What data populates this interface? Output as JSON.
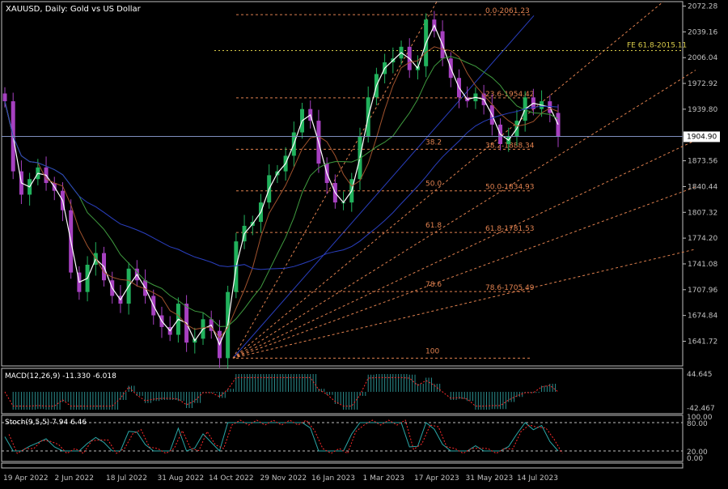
{
  "window": {
    "title": "XAUUSD, Daily:  Gold vs US Dollar"
  },
  "colors": {
    "background": "#000000",
    "grid_frame": "#c0c0c0",
    "bull_candle": "#21b15c",
    "bear_candle": "#a640c0",
    "ma_white": "#ffffff",
    "ma_brown": "#a0522d",
    "ma_green": "#3f9b3f",
    "ma_blue": "#2a3fbf",
    "fib": "#e0814f",
    "fe_line": "#d9cc4a",
    "macd_hist": "#2a8c8c",
    "macd_signal": "#ff2a2a",
    "stoch_main": "#2aa8a8",
    "stoch_signal": "#ff2a2a",
    "current_price_line": "#7f8fbf"
  },
  "price_axis": {
    "labels": [
      "2072.28",
      "2039.16",
      "2006.04",
      "1972.92",
      "1939.80",
      "1873.56",
      "1840.44",
      "1807.32",
      "1774.20",
      "1741.08",
      "1707.96",
      "1674.84",
      "1641.72"
    ],
    "current_price": "1904.90",
    "ylim": [
      1610,
      2078
    ]
  },
  "time_axis": {
    "labels": [
      "19 Apr 2022",
      "2 Jun 2022",
      "18 Jul 2022",
      "31 Aug 2022",
      "14 Oct 2022",
      "29 Nov 2022",
      "16 Jan 2023",
      "1 Mar 2023",
      "17 Apr 2023",
      "31 May 2023",
      "14 Jul 2023"
    ]
  },
  "fib_levels": [
    {
      "label": "0.0-2061.23",
      "price": 2061.23
    },
    {
      "label": "23.6-1954.42",
      "price": 1954.42
    },
    {
      "label": "38.2-1888.34",
      "price": 1888.34
    },
    {
      "label": "50.0-1834.93",
      "price": 1834.93
    },
    {
      "label": "61.8-1781.53",
      "price": 1781.53
    },
    {
      "label": "78.6-1705.49",
      "price": 1705.49
    }
  ],
  "fib_left_labels": [
    "38.2",
    "50.0",
    "61.8",
    "78.6",
    "100"
  ],
  "fe_label": "FE 61.8-2015.11",
  "macd": {
    "label": "MACD(12,26,9) -11.330 -6.018",
    "axis_top": "44.645",
    "axis_bottom": "-42.467"
  },
  "stoch": {
    "label": "Stoch(9,5,5) 7.94 6.46",
    "axis": [
      "100.00",
      "80.00",
      "20.00",
      "0.00"
    ]
  },
  "chart_data": {
    "type": "line",
    "title": "XAUUSD, Daily:  Gold vs US Dollar",
    "note": "approximate daily close path read from candles",
    "x": [
      "19 Apr 2022",
      "2 Jun 2022",
      "18 Jul 2022",
      "31 Aug 2022",
      "14 Oct 2022",
      "29 Nov 2022",
      "16 Jan 2023",
      "1 Mar 2023",
      "17 Apr 2023",
      "31 May 2023",
      "14 Jul 2023"
    ],
    "closes": [
      1950,
      1860,
      1830,
      1850,
      1865,
      1845,
      1835,
      1810,
      1730,
      1705,
      1740,
      1755,
      1720,
      1700,
      1690,
      1735,
      1720,
      1700,
      1675,
      1660,
      1650,
      1690,
      1640,
      1645,
      1670,
      1655,
      1620,
      1705,
      1770,
      1790,
      1795,
      1820,
      1855,
      1860,
      1880,
      1910,
      1940,
      1925,
      1870,
      1845,
      1820,
      1820,
      1850,
      1905,
      1955,
      1985,
      2000,
      2005,
      2020,
      1990,
      1995,
      2055,
      2040,
      2005,
      1980,
      1955,
      1950,
      1960,
      1945,
      1920,
      1895,
      1905,
      1925,
      1955,
      1940,
      1950,
      1935,
      1905
    ]
  }
}
